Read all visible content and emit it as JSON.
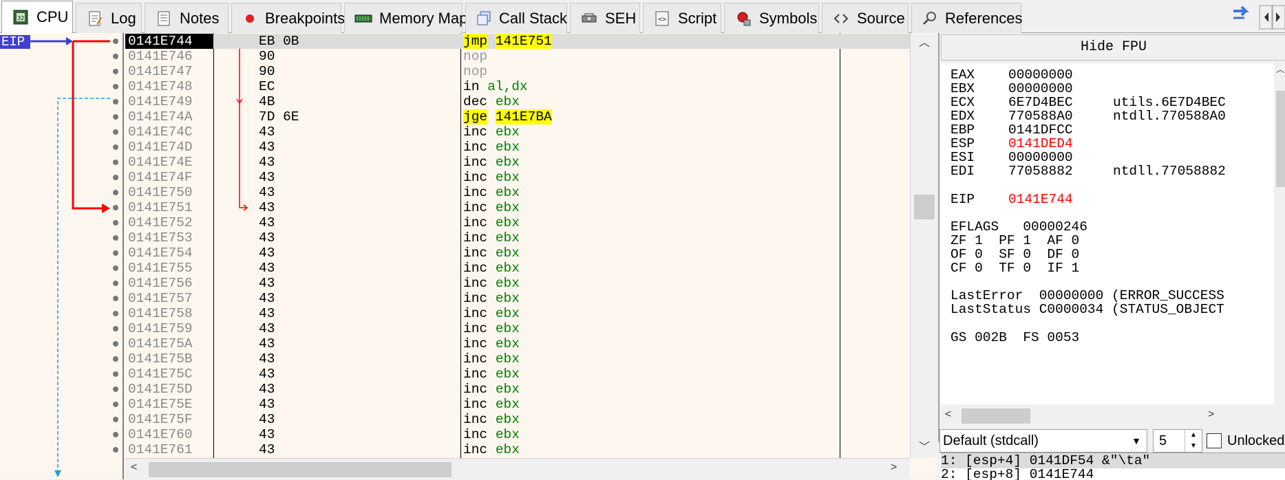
{
  "tabs": [
    {
      "label": "CPU",
      "icon": "cpu-icon",
      "active": true
    },
    {
      "label": "Log",
      "icon": "log-icon"
    },
    {
      "label": "Notes",
      "icon": "notes-icon"
    },
    {
      "label": "Breakpoints",
      "icon": "breakpoint-icon"
    },
    {
      "label": "Memory Map",
      "icon": "memory-map-icon"
    },
    {
      "label": "Call Stack",
      "icon": "call-stack-icon"
    },
    {
      "label": "SEH",
      "icon": "seh-icon"
    },
    {
      "label": "Script",
      "icon": "script-icon"
    },
    {
      "label": "Symbols",
      "icon": "symbols-icon"
    },
    {
      "label": "Source",
      "icon": "source-icon"
    },
    {
      "label": "References",
      "icon": "references-icon"
    }
  ],
  "gutter": {
    "eip_label": "EIP"
  },
  "disassembly": [
    {
      "addr": "0141E744",
      "bytes": "EB 0B",
      "mnemonic": "jmp",
      "operand": "141E751"
    },
    {
      "addr": "0141E746",
      "bytes": "90",
      "mnemonic": "nop",
      "operand": ""
    },
    {
      "addr": "0141E747",
      "bytes": "90",
      "mnemonic": "nop",
      "operand": ""
    },
    {
      "addr": "0141E748",
      "bytes": "EC",
      "mnemonic": "in",
      "operand": "al,dx"
    },
    {
      "addr": "0141E749",
      "bytes": "4B",
      "mnemonic": "dec",
      "operand": "ebx"
    },
    {
      "addr": "0141E74A",
      "bytes": "7D 6E",
      "mnemonic": "jge",
      "operand": "141E7BA"
    },
    {
      "addr": "0141E74C",
      "bytes": "43",
      "mnemonic": "inc",
      "operand": "ebx"
    },
    {
      "addr": "0141E74D",
      "bytes": "43",
      "mnemonic": "inc",
      "operand": "ebx"
    },
    {
      "addr": "0141E74E",
      "bytes": "43",
      "mnemonic": "inc",
      "operand": "ebx"
    },
    {
      "addr": "0141E74F",
      "bytes": "43",
      "mnemonic": "inc",
      "operand": "ebx"
    },
    {
      "addr": "0141E750",
      "bytes": "43",
      "mnemonic": "inc",
      "operand": "ebx"
    },
    {
      "addr": "0141E751",
      "bytes": "43",
      "mnemonic": "inc",
      "operand": "ebx"
    },
    {
      "addr": "0141E752",
      "bytes": "43",
      "mnemonic": "inc",
      "operand": "ebx"
    },
    {
      "addr": "0141E753",
      "bytes": "43",
      "mnemonic": "inc",
      "operand": "ebx"
    },
    {
      "addr": "0141E754",
      "bytes": "43",
      "mnemonic": "inc",
      "operand": "ebx"
    },
    {
      "addr": "0141E755",
      "bytes": "43",
      "mnemonic": "inc",
      "operand": "ebx"
    },
    {
      "addr": "0141E756",
      "bytes": "43",
      "mnemonic": "inc",
      "operand": "ebx"
    },
    {
      "addr": "0141E757",
      "bytes": "43",
      "mnemonic": "inc",
      "operand": "ebx"
    },
    {
      "addr": "0141E758",
      "bytes": "43",
      "mnemonic": "inc",
      "operand": "ebx"
    },
    {
      "addr": "0141E759",
      "bytes": "43",
      "mnemonic": "inc",
      "operand": "ebx"
    },
    {
      "addr": "0141E75A",
      "bytes": "43",
      "mnemonic": "inc",
      "operand": "ebx"
    },
    {
      "addr": "0141E75B",
      "bytes": "43",
      "mnemonic": "inc",
      "operand": "ebx"
    },
    {
      "addr": "0141E75C",
      "bytes": "43",
      "mnemonic": "inc",
      "operand": "ebx"
    },
    {
      "addr": "0141E75D",
      "bytes": "43",
      "mnemonic": "inc",
      "operand": "ebx"
    },
    {
      "addr": "0141E75E",
      "bytes": "43",
      "mnemonic": "inc",
      "operand": "ebx"
    },
    {
      "addr": "0141E75F",
      "bytes": "43",
      "mnemonic": "inc",
      "operand": "ebx"
    },
    {
      "addr": "0141E760",
      "bytes": "43",
      "mnemonic": "inc",
      "operand": "ebx"
    },
    {
      "addr": "0141E761",
      "bytes": "43",
      "mnemonic": "inc",
      "operand": "ebx"
    }
  ],
  "registers": {
    "hide_fpu_label": "Hide FPU",
    "gp": [
      {
        "name": "EAX",
        "value": "00000000",
        "comment": ""
      },
      {
        "name": "EBX",
        "value": "00000000",
        "comment": ""
      },
      {
        "name": "ECX",
        "value": "6E7D4BEC",
        "comment": "utils.6E7D4BEC"
      },
      {
        "name": "EDX",
        "value": "770588A0",
        "comment": "ntdll.770588A0"
      },
      {
        "name": "EBP",
        "value": "0141DFCC",
        "comment": ""
      },
      {
        "name": "ESP",
        "value": "0141DED4",
        "comment": "",
        "changed": true
      },
      {
        "name": "ESI",
        "value": "00000000",
        "comment": ""
      },
      {
        "name": "EDI",
        "value": "77058882",
        "comment": "ntdll.77058882"
      }
    ],
    "eip": {
      "name": "EIP",
      "value": "0141E744"
    },
    "eflags": "EFLAGS   00000246",
    "flags_lines": [
      "ZF 1  PF 1  AF 0",
      "OF 0  SF 0  DF 0",
      "CF 0  TF 0  IF 1"
    ],
    "last_error": "LastError  00000000 (ERROR_SUCCESS",
    "last_status": "LastStatus C0000034 (STATUS_OBJECT",
    "segments": "GS 002B  FS 0053"
  },
  "call_convention": {
    "selected": "Default (stdcall)"
  },
  "arg_count": "5",
  "unlocked_label": "Unlocked",
  "stack_rows": [
    "1: [esp+4] 0141DF54 &\"\\ta\"",
    "2: [esp+8] 0141E744"
  ],
  "colors": {
    "accent_eip": "#4040d0",
    "jump_arrow": "#ff0000",
    "highlight": "#ffff00",
    "operand": "#008000",
    "register_changed": "#ff0000"
  }
}
